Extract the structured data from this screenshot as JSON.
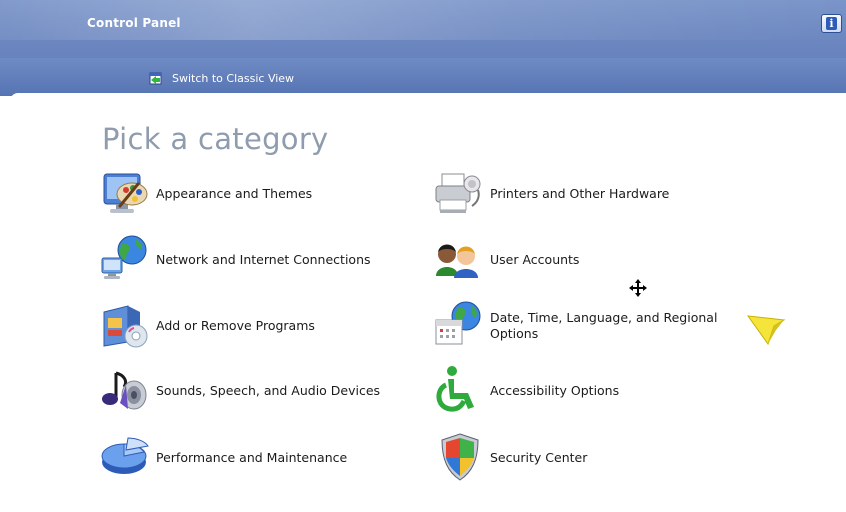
{
  "window": {
    "title": "Control Panel"
  },
  "header": {
    "switch_view_label": "Switch to Classic View"
  },
  "main": {
    "heading": "Pick a category",
    "categories": [
      {
        "label": "Appearance and Themes",
        "icon": "appearance-themes-icon"
      },
      {
        "label": "Printers and Other Hardware",
        "icon": "printer-icon"
      },
      {
        "label": "Network and Internet Connections",
        "icon": "network-globe-icon"
      },
      {
        "label": "User Accounts",
        "icon": "user-accounts-icon"
      },
      {
        "label": "Add or Remove Programs",
        "icon": "add-remove-programs-icon"
      },
      {
        "label": "Date, Time, Language, and Regional Options",
        "icon": "date-time-globe-icon"
      },
      {
        "label": "Sounds, Speech, and Audio Devices",
        "icon": "sounds-speaker-icon"
      },
      {
        "label": "Accessibility Options",
        "icon": "accessibility-icon"
      },
      {
        "label": "Performance and Maintenance",
        "icon": "performance-pie-icon"
      },
      {
        "label": "Security Center",
        "icon": "security-shield-icon"
      }
    ]
  },
  "colors": {
    "header_blue": "#6c87c0",
    "heading_gray": "#8e9cae",
    "text": "#1b1b1b",
    "cursor_yellow": "#f5e53a"
  }
}
